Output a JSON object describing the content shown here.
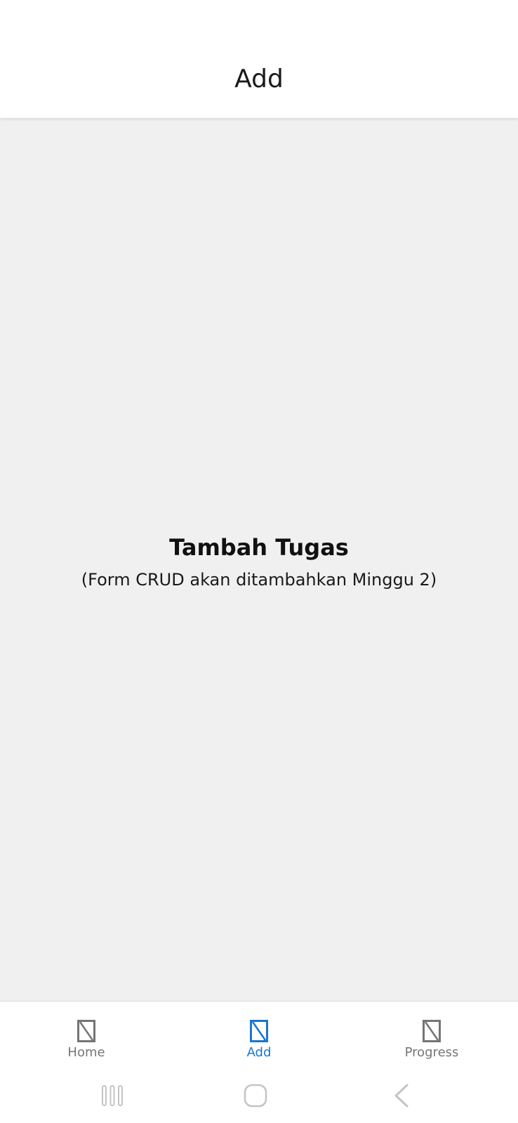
{
  "header": {
    "title": "Add"
  },
  "main": {
    "title": "Tambah Tugas",
    "subtitle": "(Form CRUD akan ditambahkan Minggu 2)"
  },
  "tabs": [
    {
      "label": "Home",
      "icon": "placeholder-icon",
      "active": false
    },
    {
      "label": "Add",
      "icon": "placeholder-icon",
      "active": true
    },
    {
      "label": "Progress",
      "icon": "placeholder-icon",
      "active": false
    }
  ],
  "colors": {
    "active": "#1976d2",
    "inactive": "#757575",
    "background": "#f0f0f0",
    "surface": "#ffffff"
  },
  "system_nav": {
    "recents_icon": "recents-icon",
    "home_icon": "home-icon",
    "back_icon": "back-icon"
  }
}
